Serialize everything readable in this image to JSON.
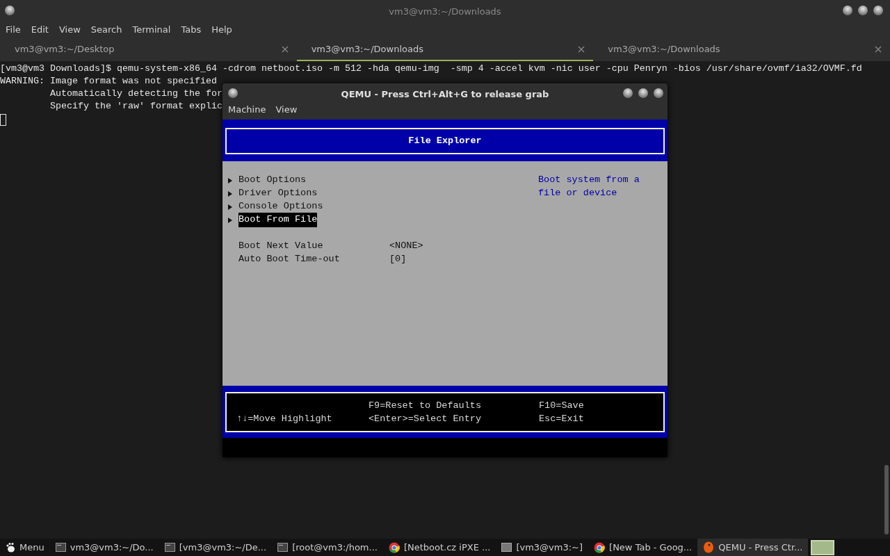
{
  "window": {
    "title": "vm3@vm3:~/Downloads"
  },
  "menu": [
    "File",
    "Edit",
    "View",
    "Search",
    "Terminal",
    "Tabs",
    "Help"
  ],
  "tabs": [
    {
      "label": "vm3@vm3:~/Desktop",
      "selected": false
    },
    {
      "label": "vm3@vm3:~/Downloads",
      "selected": true
    },
    {
      "label": "vm3@vm3:~/Downloads",
      "selected": false
    }
  ],
  "terminal": {
    "lines": [
      "[vm3@vm3 Downloads]$ qemu-system-x86_64 -cdrom netboot.iso -m 512 -hda qemu-img  -smp 4 -accel kvm -nic user -cpu Penryn -bios /usr/share/ovmf/ia32/OVMF.fd",
      "WARNING: Image format was not specified",
      "         Automatically detecting the for",
      "         Specify the 'raw' format explic"
    ]
  },
  "qemu": {
    "title": "QEMU - Press Ctrl+Alt+G to release grab",
    "menu": [
      "Machine",
      "View"
    ],
    "bios": {
      "header": "File Explorer",
      "items": [
        {
          "label": "Boot Options",
          "selected": false
        },
        {
          "label": "Driver Options",
          "selected": false
        },
        {
          "label": "Console Options",
          "selected": false
        },
        {
          "label": "Boot From File",
          "selected": true
        }
      ],
      "help": [
        "Boot system from a",
        "file or device"
      ],
      "settings": [
        {
          "label": "Boot Next Value",
          "value": "<NONE>"
        },
        {
          "label": "Auto Boot Time-out",
          "value": "[0]"
        }
      ],
      "footer": [
        {
          "lines": [
            "↑↓=Move Highlight"
          ]
        },
        {
          "lines": [
            "F9=Reset to Defaults",
            "<Enter>=Select Entry"
          ]
        },
        {
          "lines": [
            "F10=Save",
            "Esc=Exit"
          ]
        }
      ]
    }
  },
  "taskbar": {
    "menu": "Menu",
    "items": [
      {
        "label": "vm3@vm3:~/Do...",
        "kind": "terminal",
        "selected": false
      },
      {
        "label": "[vm3@vm3:~/De...",
        "kind": "terminal",
        "selected": false
      },
      {
        "label": "[root@vm3:/hom...",
        "kind": "terminal",
        "selected": false
      },
      {
        "label": "[Netboot.cz iPXE ...",
        "kind": "browser",
        "selected": false
      },
      {
        "label": "[vm3@vm3:~]",
        "kind": "window",
        "selected": false
      },
      {
        "label": "[New Tab - Goog...",
        "kind": "browser",
        "selected": false
      },
      {
        "label": "QEMU - Press Ctr...",
        "kind": "qemu",
        "selected": true
      }
    ]
  }
}
